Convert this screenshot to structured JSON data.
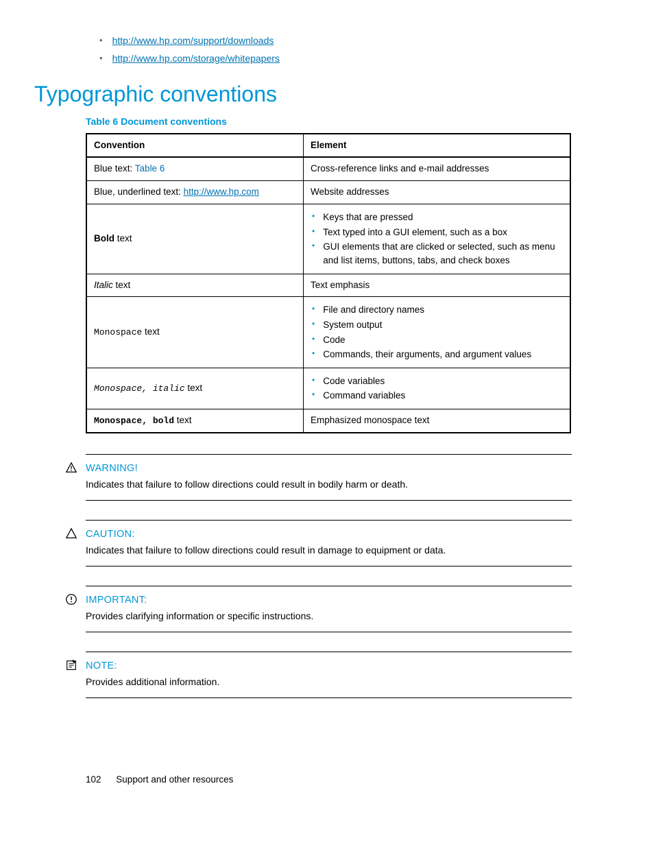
{
  "links": {
    "top": [
      "http://www.hp.com/support/downloads",
      "http://www.hp.com/storage/whitepapers"
    ]
  },
  "heading": "Typographic conventions",
  "tableCaption": "Table 6 Document conventions",
  "tableHeaders": {
    "convention": "Convention",
    "element": "Element"
  },
  "rows": {
    "blueText": {
      "prefix": "Blue text: ",
      "link": "Table 6",
      "element": "Cross-reference links and e-mail addresses"
    },
    "blueUnder": {
      "prefix": "Blue, underlined text: ",
      "link": "http://www.hp.com",
      "element": "Website addresses"
    },
    "bold": {
      "styled": "Bold",
      "suffix": " text",
      "items": [
        "Keys that are pressed",
        "Text typed into a GUI element, such as a box",
        "GUI elements that are clicked or selected, such as menu and list items, buttons, tabs, and check boxes"
      ]
    },
    "italic": {
      "styled": "Italic",
      "suffix": "  text",
      "element": "Text emphasis"
    },
    "mono": {
      "styled": "Monospace",
      "suffix": "  text",
      "items": [
        "File and directory names",
        "System output",
        "Code",
        "Commands, their arguments, and argument values"
      ]
    },
    "monoItalic": {
      "styled": "Monospace, italic",
      "suffix": "  text",
      "items": [
        "Code variables",
        "Command variables"
      ]
    },
    "monoBold": {
      "styled": "Monospace, bold",
      "suffix": "  text",
      "element": "Emphasized monospace text"
    }
  },
  "callouts": {
    "warning": {
      "title": "WARNING!",
      "body": "Indicates that failure to follow directions could result in bodily harm or death."
    },
    "caution": {
      "title": "CAUTION:",
      "body": "Indicates that failure to follow directions could result in damage to equipment or data."
    },
    "important": {
      "title": "IMPORTANT:",
      "body": "Provides clarifying information or specific instructions."
    },
    "note": {
      "title": "NOTE:",
      "body": "Provides additional information."
    }
  },
  "footer": {
    "page": "102",
    "section": "Support and other resources"
  }
}
